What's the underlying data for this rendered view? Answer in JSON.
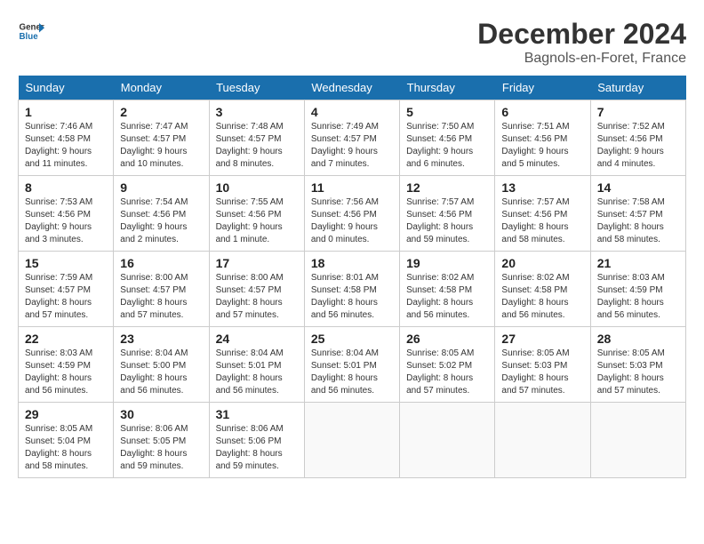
{
  "header": {
    "logo_line1": "General",
    "logo_line2": "Blue",
    "month_title": "December 2024",
    "location": "Bagnols-en-Foret, France"
  },
  "days_of_week": [
    "Sunday",
    "Monday",
    "Tuesday",
    "Wednesday",
    "Thursday",
    "Friday",
    "Saturday"
  ],
  "weeks": [
    [
      {
        "day": "1",
        "sunrise": "Sunrise: 7:46 AM",
        "sunset": "Sunset: 4:58 PM",
        "daylight": "Daylight: 9 hours and 11 minutes."
      },
      {
        "day": "2",
        "sunrise": "Sunrise: 7:47 AM",
        "sunset": "Sunset: 4:57 PM",
        "daylight": "Daylight: 9 hours and 10 minutes."
      },
      {
        "day": "3",
        "sunrise": "Sunrise: 7:48 AM",
        "sunset": "Sunset: 4:57 PM",
        "daylight": "Daylight: 9 hours and 8 minutes."
      },
      {
        "day": "4",
        "sunrise": "Sunrise: 7:49 AM",
        "sunset": "Sunset: 4:57 PM",
        "daylight": "Daylight: 9 hours and 7 minutes."
      },
      {
        "day": "5",
        "sunrise": "Sunrise: 7:50 AM",
        "sunset": "Sunset: 4:56 PM",
        "daylight": "Daylight: 9 hours and 6 minutes."
      },
      {
        "day": "6",
        "sunrise": "Sunrise: 7:51 AM",
        "sunset": "Sunset: 4:56 PM",
        "daylight": "Daylight: 9 hours and 5 minutes."
      },
      {
        "day": "7",
        "sunrise": "Sunrise: 7:52 AM",
        "sunset": "Sunset: 4:56 PM",
        "daylight": "Daylight: 9 hours and 4 minutes."
      }
    ],
    [
      {
        "day": "8",
        "sunrise": "Sunrise: 7:53 AM",
        "sunset": "Sunset: 4:56 PM",
        "daylight": "Daylight: 9 hours and 3 minutes."
      },
      {
        "day": "9",
        "sunrise": "Sunrise: 7:54 AM",
        "sunset": "Sunset: 4:56 PM",
        "daylight": "Daylight: 9 hours and 2 minutes."
      },
      {
        "day": "10",
        "sunrise": "Sunrise: 7:55 AM",
        "sunset": "Sunset: 4:56 PM",
        "daylight": "Daylight: 9 hours and 1 minute."
      },
      {
        "day": "11",
        "sunrise": "Sunrise: 7:56 AM",
        "sunset": "Sunset: 4:56 PM",
        "daylight": "Daylight: 9 hours and 0 minutes."
      },
      {
        "day": "12",
        "sunrise": "Sunrise: 7:57 AM",
        "sunset": "Sunset: 4:56 PM",
        "daylight": "Daylight: 8 hours and 59 minutes."
      },
      {
        "day": "13",
        "sunrise": "Sunrise: 7:57 AM",
        "sunset": "Sunset: 4:56 PM",
        "daylight": "Daylight: 8 hours and 58 minutes."
      },
      {
        "day": "14",
        "sunrise": "Sunrise: 7:58 AM",
        "sunset": "Sunset: 4:57 PM",
        "daylight": "Daylight: 8 hours and 58 minutes."
      }
    ],
    [
      {
        "day": "15",
        "sunrise": "Sunrise: 7:59 AM",
        "sunset": "Sunset: 4:57 PM",
        "daylight": "Daylight: 8 hours and 57 minutes."
      },
      {
        "day": "16",
        "sunrise": "Sunrise: 8:00 AM",
        "sunset": "Sunset: 4:57 PM",
        "daylight": "Daylight: 8 hours and 57 minutes."
      },
      {
        "day": "17",
        "sunrise": "Sunrise: 8:00 AM",
        "sunset": "Sunset: 4:57 PM",
        "daylight": "Daylight: 8 hours and 57 minutes."
      },
      {
        "day": "18",
        "sunrise": "Sunrise: 8:01 AM",
        "sunset": "Sunset: 4:58 PM",
        "daylight": "Daylight: 8 hours and 56 minutes."
      },
      {
        "day": "19",
        "sunrise": "Sunrise: 8:02 AM",
        "sunset": "Sunset: 4:58 PM",
        "daylight": "Daylight: 8 hours and 56 minutes."
      },
      {
        "day": "20",
        "sunrise": "Sunrise: 8:02 AM",
        "sunset": "Sunset: 4:58 PM",
        "daylight": "Daylight: 8 hours and 56 minutes."
      },
      {
        "day": "21",
        "sunrise": "Sunrise: 8:03 AM",
        "sunset": "Sunset: 4:59 PM",
        "daylight": "Daylight: 8 hours and 56 minutes."
      }
    ],
    [
      {
        "day": "22",
        "sunrise": "Sunrise: 8:03 AM",
        "sunset": "Sunset: 4:59 PM",
        "daylight": "Daylight: 8 hours and 56 minutes."
      },
      {
        "day": "23",
        "sunrise": "Sunrise: 8:04 AM",
        "sunset": "Sunset: 5:00 PM",
        "daylight": "Daylight: 8 hours and 56 minutes."
      },
      {
        "day": "24",
        "sunrise": "Sunrise: 8:04 AM",
        "sunset": "Sunset: 5:01 PM",
        "daylight": "Daylight: 8 hours and 56 minutes."
      },
      {
        "day": "25",
        "sunrise": "Sunrise: 8:04 AM",
        "sunset": "Sunset: 5:01 PM",
        "daylight": "Daylight: 8 hours and 56 minutes."
      },
      {
        "day": "26",
        "sunrise": "Sunrise: 8:05 AM",
        "sunset": "Sunset: 5:02 PM",
        "daylight": "Daylight: 8 hours and 57 minutes."
      },
      {
        "day": "27",
        "sunrise": "Sunrise: 8:05 AM",
        "sunset": "Sunset: 5:03 PM",
        "daylight": "Daylight: 8 hours and 57 minutes."
      },
      {
        "day": "28",
        "sunrise": "Sunrise: 8:05 AM",
        "sunset": "Sunset: 5:03 PM",
        "daylight": "Daylight: 8 hours and 57 minutes."
      }
    ],
    [
      {
        "day": "29",
        "sunrise": "Sunrise: 8:05 AM",
        "sunset": "Sunset: 5:04 PM",
        "daylight": "Daylight: 8 hours and 58 minutes."
      },
      {
        "day": "30",
        "sunrise": "Sunrise: 8:06 AM",
        "sunset": "Sunset: 5:05 PM",
        "daylight": "Daylight: 8 hours and 59 minutes."
      },
      {
        "day": "31",
        "sunrise": "Sunrise: 8:06 AM",
        "sunset": "Sunset: 5:06 PM",
        "daylight": "Daylight: 8 hours and 59 minutes."
      },
      null,
      null,
      null,
      null
    ]
  ]
}
